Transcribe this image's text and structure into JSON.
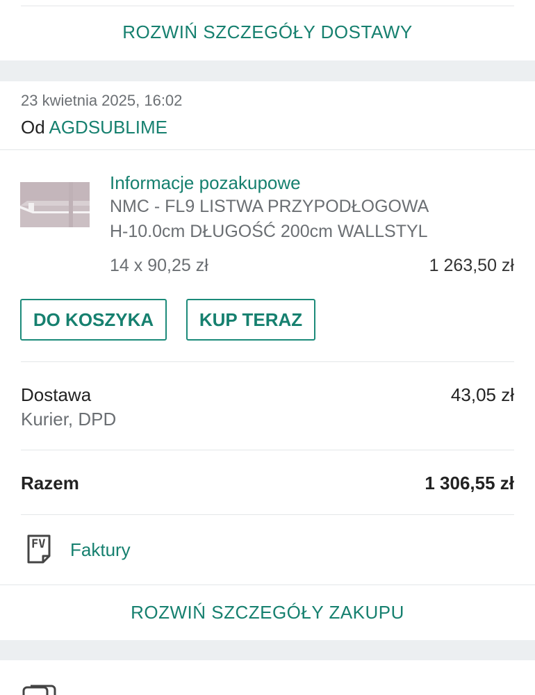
{
  "delivery_details": {
    "expand_label": "ROZWIŃ SZCZEGÓŁY DOSTAWY"
  },
  "order": {
    "date": "23 kwietnia 2025, 16:02",
    "from_prefix": "Od",
    "seller": "AGDSUBLIME"
  },
  "item": {
    "info_link": "Informacje pozakupowe",
    "title_line1": "NMC - FL9 LISTWA PRZYPODŁOGOWA",
    "title_line2": "H-10.0cm DŁUGOŚĆ 200cm WALLSTYL",
    "quantity_price": "14 x 90,25 zł",
    "total": "1 263,50 zł"
  },
  "actions": {
    "add_to_cart": "DO KOSZYKA",
    "buy_now": "KUP TERAZ"
  },
  "shipping": {
    "label": "Dostawa",
    "method": "Kurier, DPD",
    "price": "43,05 zł"
  },
  "summary": {
    "label": "Razem",
    "total": "1 306,55 zł"
  },
  "invoices": {
    "icon_text": "FV",
    "label": "Faktury"
  },
  "purchase_details": {
    "expand_label": "ROZWIŃ SZCZEGÓŁY ZAKUPU"
  },
  "colors": {
    "accent": "#16806f",
    "band": "#eceff1",
    "divider": "#e3e6e8"
  }
}
